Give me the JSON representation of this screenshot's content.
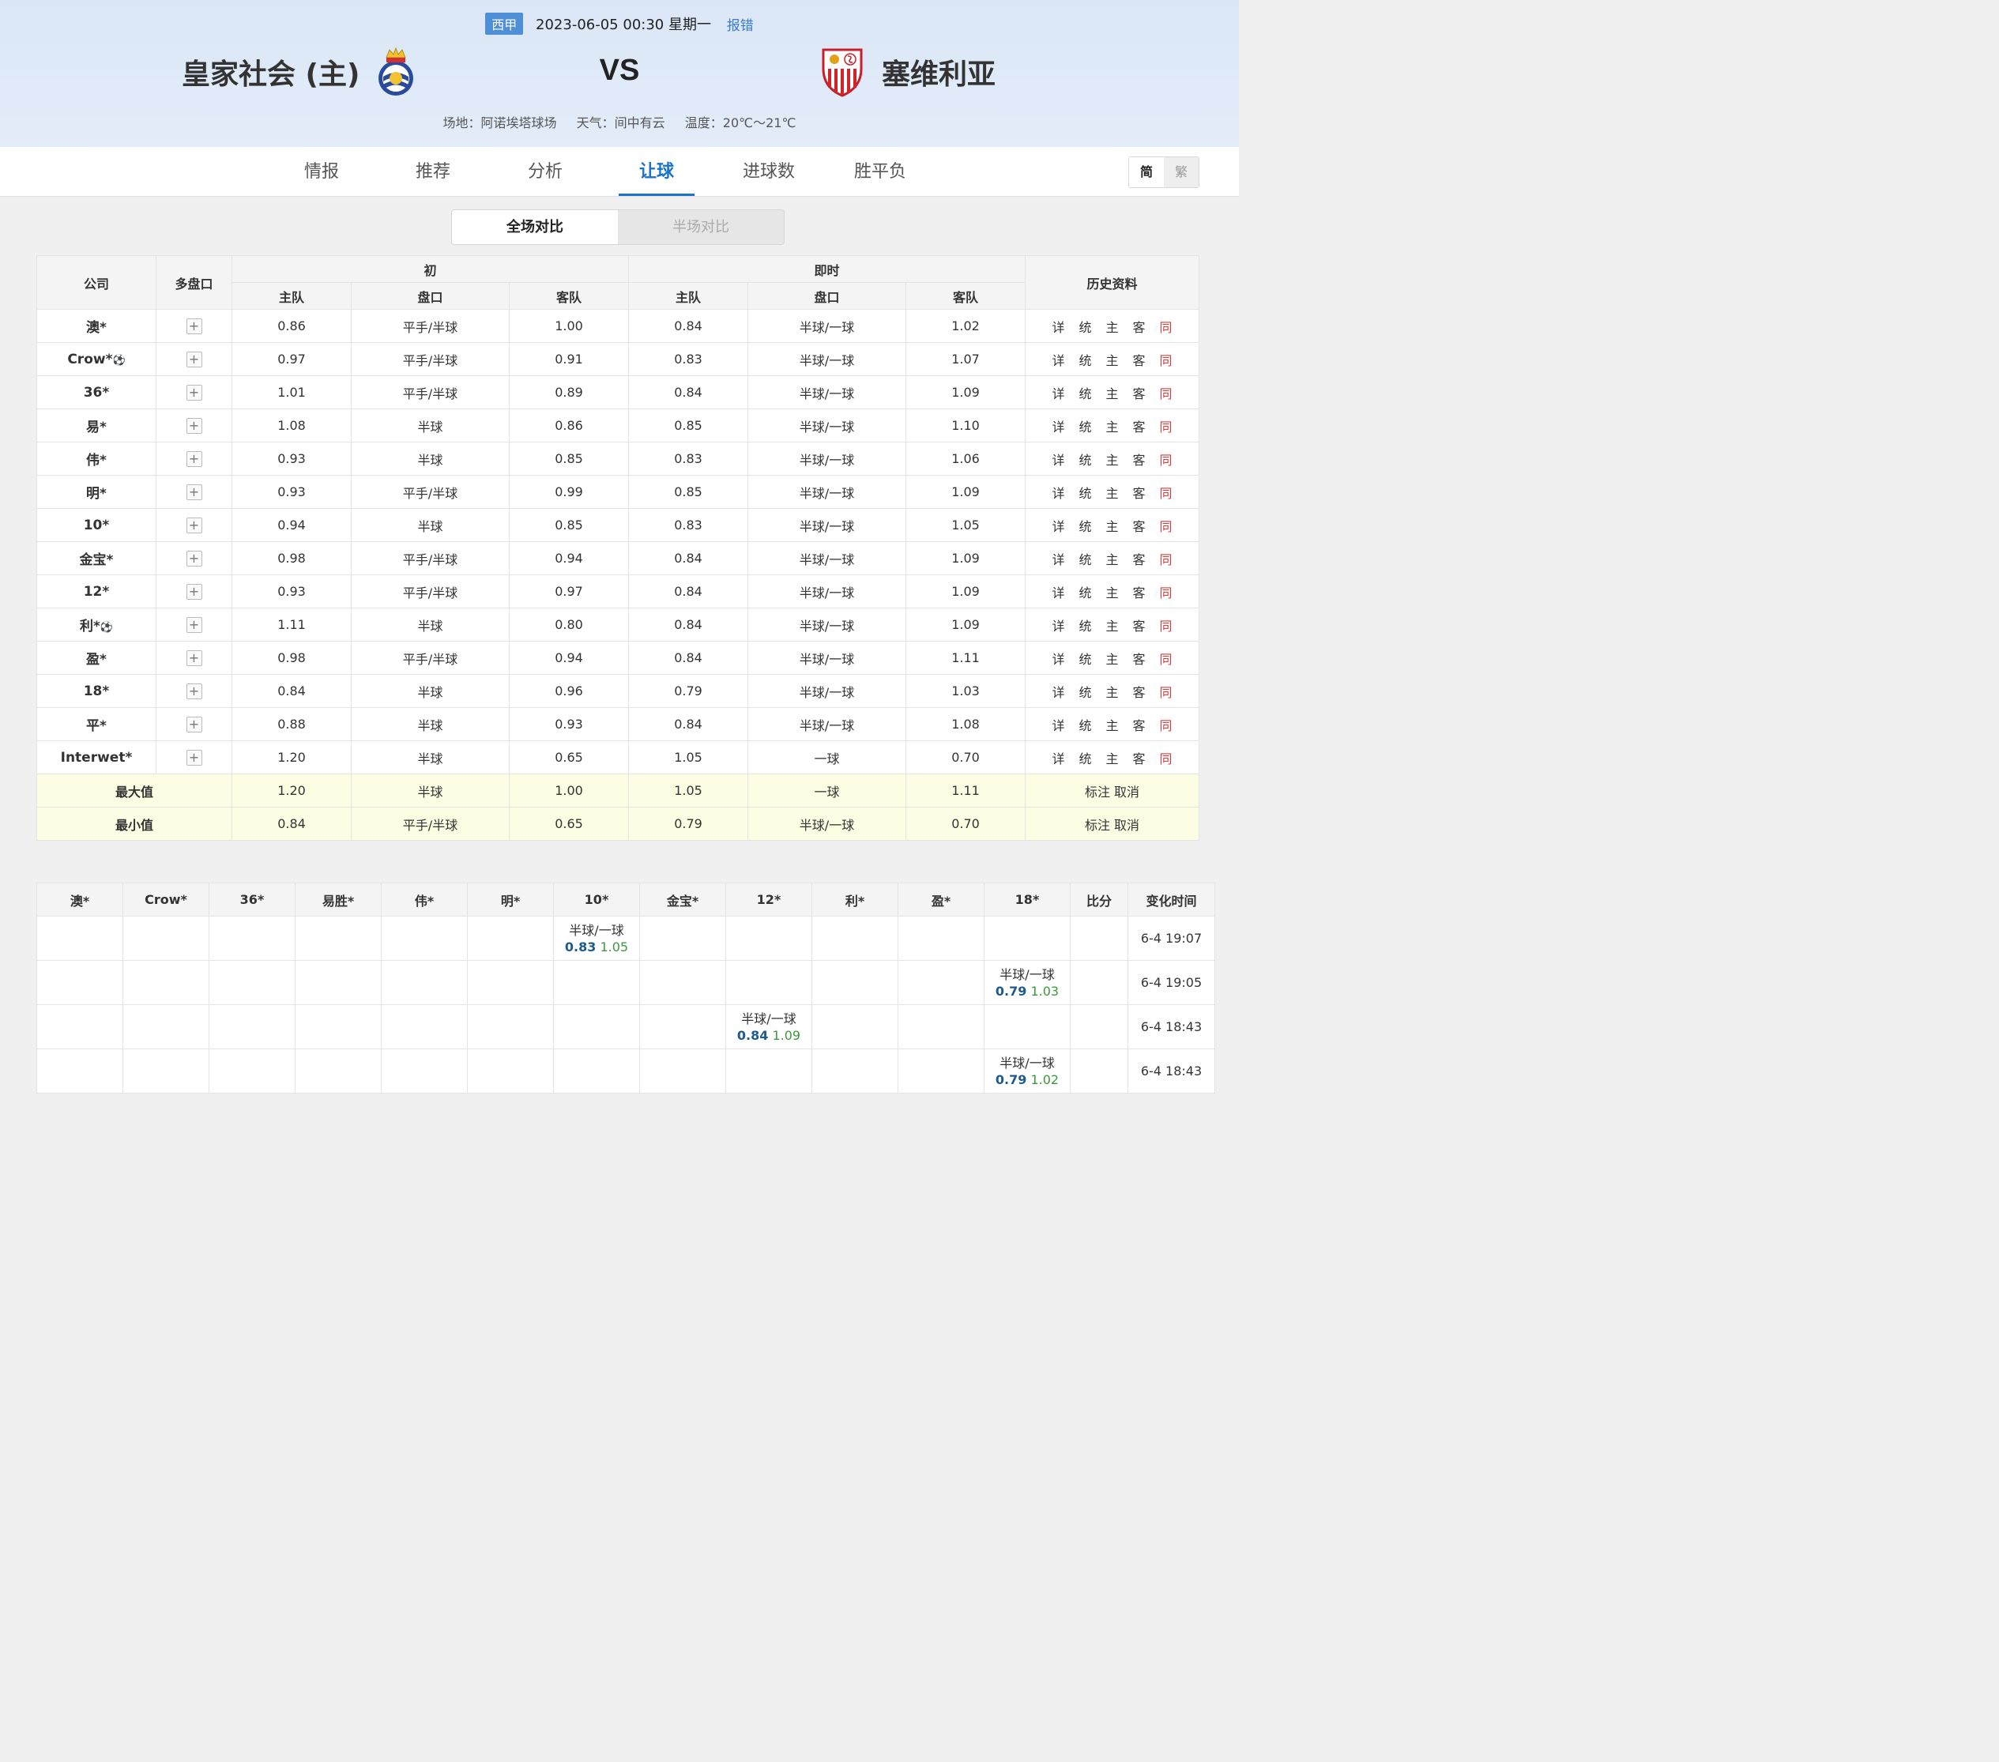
{
  "header": {
    "league": "西甲",
    "datetime": "2023-06-05 00:30 星期一",
    "report": "报错",
    "home_team": "皇家社会 (主)",
    "away_team": "塞维利亚",
    "vs": "VS",
    "venue": "场地：阿诺埃塔球场",
    "weather": "天气：间中有云",
    "temperature": "温度：20℃～21℃"
  },
  "tabs": [
    {
      "label": "情报"
    },
    {
      "label": "推荐"
    },
    {
      "label": "分析"
    },
    {
      "label": "让球",
      "active": true
    },
    {
      "label": "进球数"
    },
    {
      "label": "胜平负"
    }
  ],
  "lang": {
    "simplified": "简",
    "traditional": "繁"
  },
  "compare": {
    "full": "全场对比",
    "half": "半场对比"
  },
  "odds_table": {
    "headers": {
      "company": "公司",
      "multi": "多盘口",
      "initial": "初",
      "live": "即时",
      "history": "历史资料",
      "home": "主队",
      "line": "盘口",
      "away": "客队"
    },
    "history_links": [
      "详",
      "统",
      "主",
      "客",
      "同"
    ],
    "rows": [
      {
        "company": "澳*",
        "ball": false,
        "i_home": "0.86",
        "i_line": "平手/半球",
        "i_away": "1.00",
        "l_home": "0.84",
        "l_line": "半球/一球",
        "l_away": "1.02"
      },
      {
        "company": "Crow*",
        "ball": true,
        "i_home": "0.97",
        "i_line": "平手/半球",
        "i_away": "0.91",
        "l_home": "0.83",
        "l_line": "半球/一球",
        "l_away": "1.07"
      },
      {
        "company": "36*",
        "ball": false,
        "i_home": "1.01",
        "i_line": "平手/半球",
        "i_away": "0.89",
        "l_home": "0.84",
        "l_line": "半球/一球",
        "l_away": "1.09"
      },
      {
        "company": "易*",
        "ball": false,
        "i_home": "1.08",
        "i_line": "半球",
        "i_away": "0.86",
        "l_home": "0.85",
        "l_line": "半球/一球",
        "l_away": "1.10"
      },
      {
        "company": "伟*",
        "ball": false,
        "i_home": "0.93",
        "i_line": "半球",
        "i_away": "0.85",
        "l_home": "0.83",
        "l_line": "半球/一球",
        "l_away": "1.06"
      },
      {
        "company": "明*",
        "ball": false,
        "i_home": "0.93",
        "i_line": "平手/半球",
        "i_away": "0.99",
        "l_home": "0.85",
        "l_line": "半球/一球",
        "l_away": "1.09"
      },
      {
        "company": "10*",
        "ball": false,
        "i_home": "0.94",
        "i_line": "半球",
        "i_away": "0.85",
        "l_home": "0.83",
        "l_line": "半球/一球",
        "l_away": "1.05"
      },
      {
        "company": "金宝*",
        "ball": false,
        "i_home": "0.98",
        "i_line": "平手/半球",
        "i_away": "0.94",
        "l_home": "0.84",
        "l_line": "半球/一球",
        "l_away": "1.09"
      },
      {
        "company": "12*",
        "ball": false,
        "i_home": "0.93",
        "i_line": "平手/半球",
        "i_away": "0.97",
        "l_home": "0.84",
        "l_line": "半球/一球",
        "l_away": "1.09"
      },
      {
        "company": "利*",
        "ball": true,
        "i_home": "1.11",
        "i_line": "半球",
        "i_away": "0.80",
        "l_home": "0.84",
        "l_line": "半球/一球",
        "l_away": "1.09"
      },
      {
        "company": "盈*",
        "ball": false,
        "i_home": "0.98",
        "i_line": "平手/半球",
        "i_away": "0.94",
        "l_home": "0.84",
        "l_line": "半球/一球",
        "l_away": "1.11"
      },
      {
        "company": "18*",
        "ball": false,
        "i_home": "0.84",
        "i_line": "半球",
        "i_away": "0.96",
        "l_home": "0.79",
        "l_line": "半球/一球",
        "l_away": "1.03"
      },
      {
        "company": "平*",
        "ball": false,
        "i_home": "0.88",
        "i_line": "半球",
        "i_away": "0.93",
        "l_home": "0.84",
        "l_line": "半球/一球",
        "l_away": "1.08"
      },
      {
        "company": "Interwet*",
        "ball": false,
        "i_home": "1.20",
        "i_line": "半球",
        "i_away": "0.65",
        "l_home": "1.05",
        "l_line": "一球",
        "l_away": "0.70"
      }
    ],
    "stats": [
      {
        "label": "最大值",
        "i_home": "1.20",
        "i_line": "半球",
        "i_away": "1.00",
        "l_home": "1.05",
        "l_line": "一球",
        "l_away": "1.11",
        "action": "标注 取消"
      },
      {
        "label": "最小值",
        "i_home": "0.84",
        "i_line": "平手/半球",
        "i_away": "0.65",
        "l_home": "0.79",
        "l_line": "半球/一球",
        "l_away": "0.70",
        "action": "标注 取消"
      }
    ]
  },
  "change_table": {
    "headers": [
      "澳*",
      "Crow*",
      "36*",
      "易胜*",
      "伟*",
      "明*",
      "10*",
      "金宝*",
      "12*",
      "利*",
      "盈*",
      "18*",
      "比分",
      "变化时间"
    ],
    "rows": [
      {
        "col": 6,
        "line": "半球/一球",
        "home": "0.83",
        "away": "1.05",
        "time": "6-4 19:07"
      },
      {
        "col": 11,
        "line": "半球/一球",
        "home": "0.79",
        "away": "1.03",
        "time": "6-4 19:05"
      },
      {
        "col": 8,
        "line": "半球/一球",
        "home": "0.84",
        "away": "1.09",
        "time": "6-4 18:43"
      },
      {
        "col": 11,
        "line": "半球/一球",
        "home": "0.79",
        "away": "1.02",
        "time": "6-4 18:43"
      }
    ]
  }
}
